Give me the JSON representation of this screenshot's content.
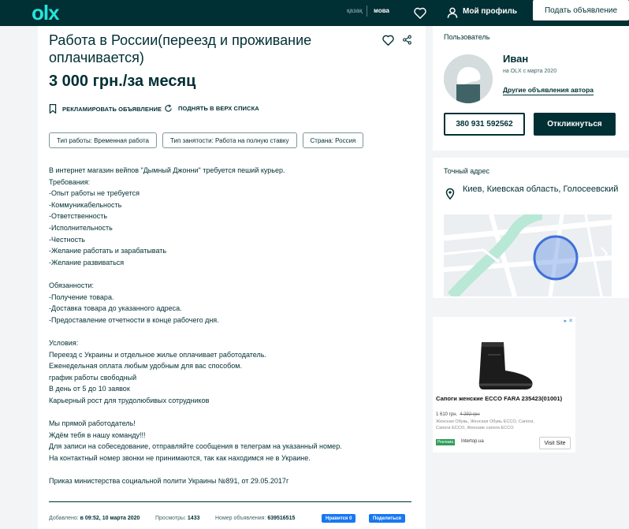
{
  "header": {
    "logo": "olx",
    "lang_kaz": "қазақ",
    "lang_mova": "мова",
    "profile_label": "Мой профиль",
    "post_button": "Подать объявление",
    "colors": {
      "bg": "#002f34",
      "logo": "#23e5db"
    },
    "icons": [
      "heart-icon",
      "chat-icon",
      "user-icon"
    ]
  },
  "listing": {
    "title": "Работа в России(переезд и проживание оплачивается)",
    "price": "3 000 грн./за месяц",
    "actions": {
      "promote": "РЕКЛАМИРОВАТЬ ОБЪЯВЛЕНИЕ",
      "raise": "ПОДНЯТЬ В ВЕРХ СПИСКА"
    },
    "tags": [
      "Тип работы: Временная работа",
      "Тип занятости: Работа на полную ставку",
      "Страна: Россия"
    ],
    "description": [
      "В интернет магазин вейпов \"Дымный Джонни\" требуется пеший курьер.",
      "Требования:",
      "-Опыт работы не требуется",
      "-Коммуникабельность",
      "-Ответственность",
      "-Исполнительность",
      "-Честность",
      "-Желание работать и зарабатывать",
      "-Желание развиваться",
      "",
      "Обязанности:",
      "-Получение товара.",
      "-Доставка товара до указанного адреса.",
      "-Предоставление отчетности в конце рабочего дня.",
      "",
      "Условия:",
      "Переезд с Украины и отдельное жилье оплачивает работодатель.",
      "Еженедельная оплата любым удобным для вас способом.",
      "график работы свободный",
      "В день от 5 до 10 заявок",
      "Карьерный рост для трудолюбивых сотрудников",
      "",
      "Мы прямой работодатель!",
      "Ждём тебя в нашу команду!!!",
      "Для записи на собеседование, отправляйте сообщения в телеграм на указанный номер.",
      "На контактный номер звонки не принимаются, так как находимся не в Украине.",
      "",
      "Приказ министерства социальной полити Украины №891, от 29.05.2017г"
    ],
    "footer": {
      "added_label": "Добавлено:",
      "added_value": "в 09:52, 10 марта 2020",
      "views_label": "Просмотры:",
      "views_value": "1433",
      "number_label": "Номер объявления:",
      "number_value": "639516515",
      "fb_like": "Нравится 0",
      "fb_share": "Поделиться"
    }
  },
  "seller": {
    "section_label": "Пользователь",
    "name": "Иван",
    "since": "на OLX с марта 2020",
    "other_ads": "Другие объявления автора",
    "phone": "380 931 592562",
    "reply_button": "Откликнуться"
  },
  "location": {
    "section_label": "Точный адрес",
    "address": "Киев, Киевская область, Голосеевский"
  },
  "ad": {
    "title": "Сапоги женские ECCO FARA 235423(01001)",
    "price": "1 610 грн.",
    "old_price": "4 292 грн",
    "description": "Женская Обувь, Женская Обувь ECCO, Сапоги, Сапоги ECCO, Женские сапоги ECCO",
    "tag": "Реклама",
    "shop": "Intertop.ua",
    "visit": "Visit Site"
  }
}
